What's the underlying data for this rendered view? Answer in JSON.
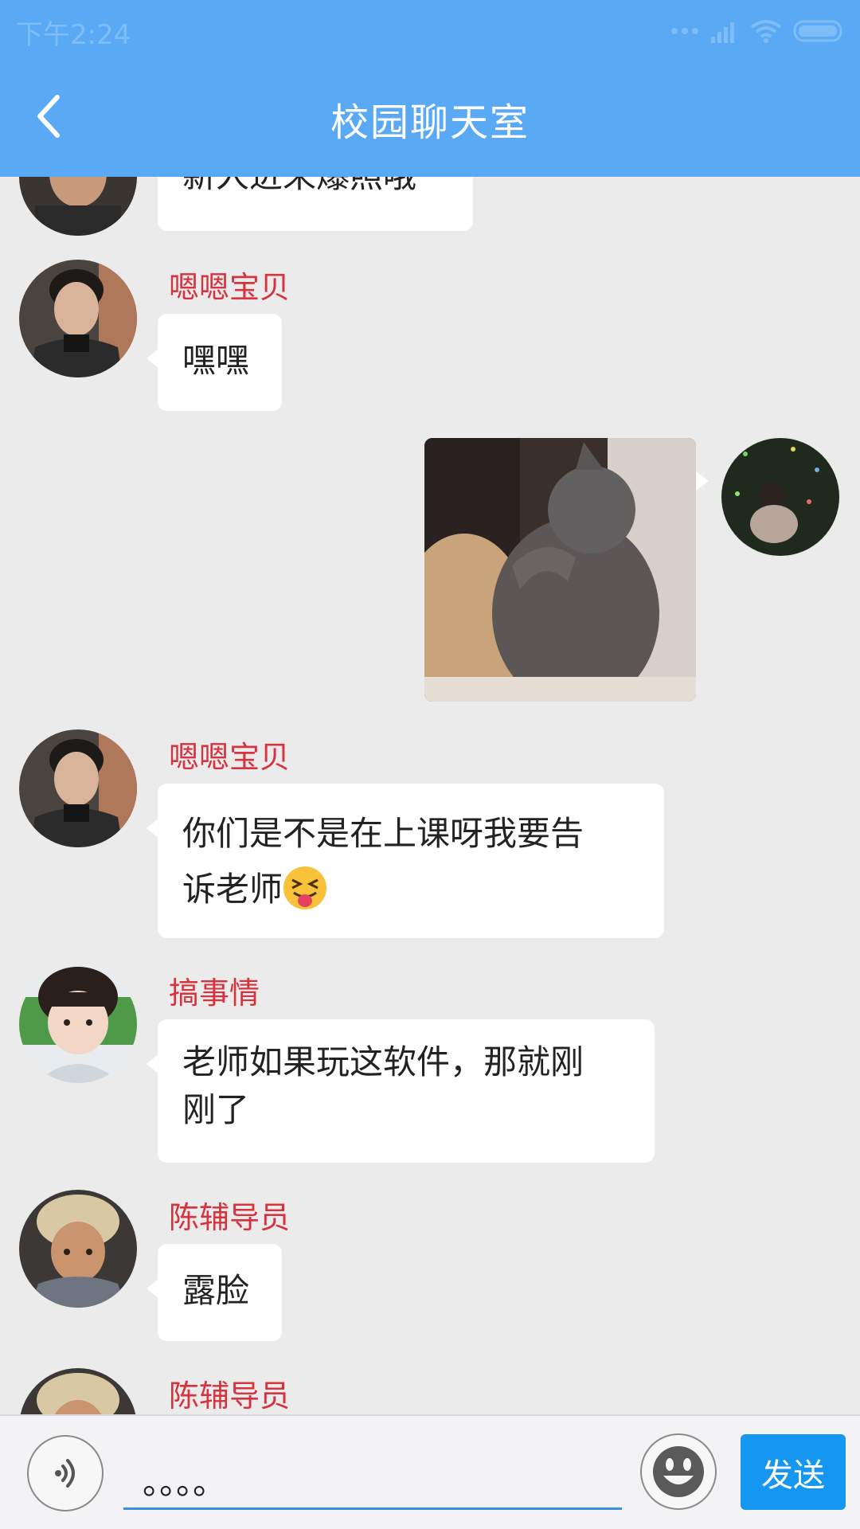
{
  "status_bar": {
    "time": "下午2:24"
  },
  "header": {
    "title": "校园聊天室",
    "back_icon": "chevron-left-icon"
  },
  "messages": [
    {
      "direction": "incoming",
      "text": "新人进来爆照哦"
    },
    {
      "direction": "incoming",
      "sender": "嗯嗯宝贝",
      "text": "嘿嘿"
    },
    {
      "direction": "outgoing",
      "type": "image",
      "image_desc": "gray-cat-photo"
    },
    {
      "direction": "incoming",
      "sender": "嗯嗯宝贝",
      "text_line1": "你们是不是在上课呀我要告",
      "text_line2": "诉老师",
      "emoji": "face-with-tongue-squinting"
    },
    {
      "direction": "incoming",
      "sender": "搞事情",
      "text_line1": "老师如果玩这软件，那就刚",
      "text_line2": "刚了"
    },
    {
      "direction": "incoming",
      "sender": "陈辅导员",
      "text": "露脸"
    },
    {
      "direction": "incoming",
      "sender": "陈辅导员"
    }
  ],
  "input_bar": {
    "voice_icon": "voice-icon",
    "input_value": "。。。。",
    "emoji_icon": "smiley-icon",
    "send_label": "发送"
  },
  "colors": {
    "header_bg": "#5aa9f5",
    "sender_name": "#d6333f",
    "chat_bg": "#ebebeb",
    "send_button": "#1596f0"
  }
}
